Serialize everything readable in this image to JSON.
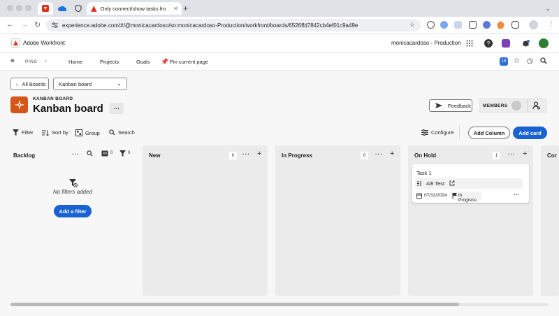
{
  "browser": {
    "active_tab_title": "Only connect/show tasks fro",
    "tab_close": "×",
    "new_tab": "+",
    "url": "experience.adobe.com/#/@monicacardoso/so:monicacardoso-Production/workfront/boards/6526ffd7842cb4ef01c9a49e"
  },
  "app_header": {
    "app_name": "Adobe Workfront",
    "instance": "monicacardoso - Production"
  },
  "nav": {
    "pins_label": "PINS",
    "home": "Home",
    "projects": "Projects",
    "goals": "Goals",
    "pin_current_page": "Pin current page",
    "notification_count": "19"
  },
  "board": {
    "all_boards": "All Boards",
    "board_select": "Kanban board",
    "kicker": "KANBAN BOARD",
    "title": "Kanban board",
    "more": "···",
    "feedback": "Feedback",
    "members": "MEMBERS"
  },
  "toolbar": {
    "filter": "Filter",
    "sort_by": "Sort by",
    "group": "Group",
    "search": "Search",
    "configure": "Configure",
    "add_column": "Add Column",
    "add_card": "Add card"
  },
  "backlog": {
    "title": "Backlog",
    "display_count": "0",
    "filter_count": "0",
    "empty_text": "No filters added",
    "add_filter": "Add a filter"
  },
  "columns": [
    {
      "title": "New",
      "count": "0"
    },
    {
      "title": "In Progress",
      "count": "0"
    },
    {
      "title": "On Hold",
      "count": "1"
    },
    {
      "title": "Cor"
    }
  ],
  "card": {
    "title": "Task 1",
    "project": "4/8 Test",
    "due_date": "07/31/2024",
    "status": "In Progress"
  }
}
